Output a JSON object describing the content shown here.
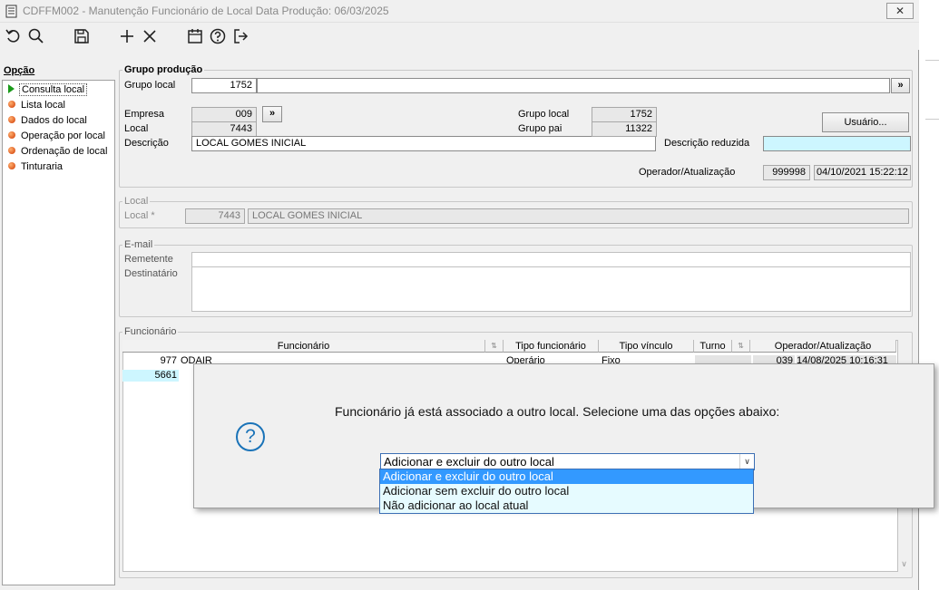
{
  "window": {
    "title": "CDFFM002 - Manutenção Funcionário de Local Data Produção: 06/03/2025",
    "close_label": "✕"
  },
  "toolbar": {
    "icons": [
      "undo-icon",
      "search-icon",
      "save-icon",
      "add-icon",
      "delete-icon",
      "calendar-icon",
      "help-icon",
      "exit-icon"
    ]
  },
  "sidebar": {
    "title": "Opção",
    "items": [
      {
        "label": "Consulta local"
      },
      {
        "label": "Lista local"
      },
      {
        "label": "Dados do local"
      },
      {
        "label": "Operação por local"
      },
      {
        "label": "Ordenação de local"
      },
      {
        "label": "Tinturaria"
      }
    ]
  },
  "grupo_producao": {
    "title": "Grupo produção",
    "grupo_local_label": "Grupo local",
    "grupo_local_value": "1752",
    "empresa_label": "Empresa",
    "empresa_value": "009",
    "local_label": "Local",
    "local_value": "7443",
    "descricao_label": "Descrição",
    "descricao_value": "LOCAL GOMES INICIAL",
    "grupo_local2_label": "Grupo local",
    "grupo_local2_value": "1752",
    "grupo_pai_label": "Grupo pai",
    "grupo_pai_value": "11322",
    "usuario_button": "Usuário...",
    "descricao_reduzida_label": "Descrição reduzida",
    "descricao_reduzida_value": "",
    "operador_label": "Operador/Atualização",
    "operador_value": "999998",
    "atualizacao_value": "04/10/2021 15:22:12",
    "nav_button": "»"
  },
  "local_group": {
    "title": "Local",
    "local_label": "Local *",
    "local_code": "7443",
    "local_desc": "LOCAL GOMES INICIAL"
  },
  "email_group": {
    "title": "E-mail",
    "remetente_label": "Remetente",
    "destinatario_label": "Destinatário",
    "remetente_value": "",
    "destinatario_value": ""
  },
  "funcionario_group": {
    "title": "Funcionário",
    "columns": [
      "Funcionário",
      "Tipo funcionário",
      "Tipo vínculo",
      "Turno",
      "Operador/Atualização"
    ],
    "rows": [
      {
        "code": "977",
        "name": "ODAIR",
        "tipo_funcionario": "Operário",
        "tipo_vinculo": "Fixo",
        "operador": "039",
        "atualizacao": "14/08/2025 10:16:31"
      },
      {
        "code": "5661",
        "name": "",
        "tipo_funcionario": "",
        "tipo_vinculo": "",
        "operador": "",
        "atualizacao": ""
      }
    ]
  },
  "dialog": {
    "message": "Funcionário já está associado a outro local. Selecione uma das opções abaixo:",
    "icon": "question-icon",
    "selected": "Adicionar e excluir do outro local",
    "options": [
      "Adicionar e excluir do outro local",
      "Adicionar sem excluir do outro local",
      "Não adicionar ao local atual"
    ]
  },
  "colors": {
    "accent": "#3399ff",
    "highlight": "#cdf6ff",
    "dialog_border": "#3c6fb4"
  }
}
